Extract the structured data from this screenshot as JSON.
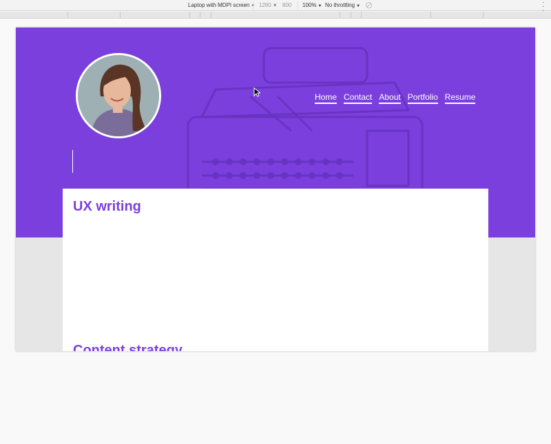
{
  "devtools": {
    "device": "Laptop with MDPI screen",
    "width": "1280",
    "times": "×",
    "height": "800",
    "zoom": "100%",
    "throttling": "No throttling",
    "menu_icon": "more-vert-icon",
    "rotate_icon": "throttle-off-icon"
  },
  "site": {
    "accent_color": "#7b3fdd",
    "avatar_alt": "profile-photo",
    "nav": [
      {
        "label": "Home"
      },
      {
        "label": "Contact"
      },
      {
        "label": "About"
      },
      {
        "label": "Portfolio"
      },
      {
        "label": "Resume"
      }
    ],
    "sections": [
      {
        "title": "UX writing"
      },
      {
        "title": "Content strategy"
      }
    ]
  }
}
